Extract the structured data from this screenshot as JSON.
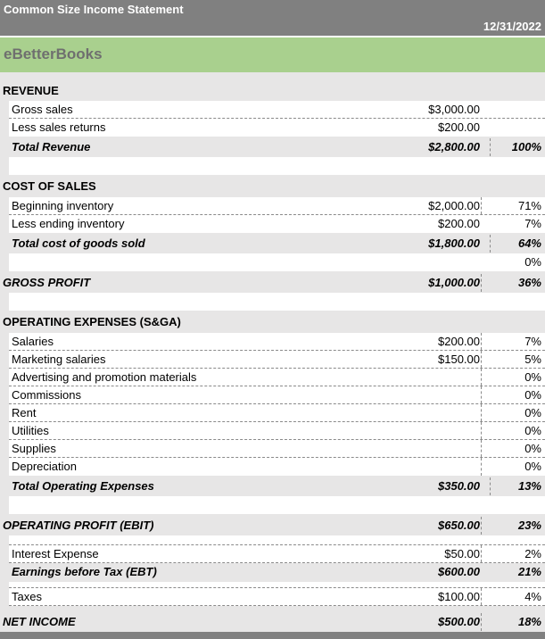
{
  "header": {
    "title": "Common Size Income Statement",
    "date": "12/31/2022",
    "company": "eBetterBooks"
  },
  "colors": {
    "title_bar": "#808080",
    "brand_band": "#a9d08e",
    "section_fill": "#e7e6e6"
  },
  "revenue": {
    "heading": "REVENUE",
    "items": [
      {
        "label": "Gross sales",
        "amount": "$3,000.00",
        "percent": ""
      },
      {
        "label": "Less sales returns",
        "amount": "$200.00",
        "percent": ""
      }
    ],
    "total": {
      "label": "Total Revenue",
      "amount": "$2,800.00",
      "percent": "100%"
    }
  },
  "cost_of_sales": {
    "heading": "COST OF SALES",
    "items": [
      {
        "label": "Beginning inventory",
        "amount": "$2,000.00",
        "percent": "71%"
      },
      {
        "label": "Less ending inventory",
        "amount": "$200.00",
        "percent": "7%"
      }
    ],
    "total": {
      "label": "Total cost of goods sold",
      "amount": "$1,800.00",
      "percent": "64%"
    },
    "extra_percent": "0%"
  },
  "gross_profit": {
    "label": "GROSS PROFIT",
    "amount": "$1,000.00",
    "percent": "36%"
  },
  "operating_expenses": {
    "heading": "OPERATING EXPENSES (S&GA)",
    "items": [
      {
        "label": "Salaries",
        "amount": "$200.00",
        "percent": "7%"
      },
      {
        "label": "Marketing salaries",
        "amount": "$150.00",
        "percent": "5%"
      },
      {
        "label": "Advertising and promotion materials",
        "amount": "",
        "percent": "0%"
      },
      {
        "label": "Commissions",
        "amount": "",
        "percent": "0%"
      },
      {
        "label": "Rent",
        "amount": "",
        "percent": "0%"
      },
      {
        "label": "Utilities",
        "amount": "",
        "percent": "0%"
      },
      {
        "label": "Supplies",
        "amount": "",
        "percent": "0%"
      },
      {
        "label": "Depreciation",
        "amount": "",
        "percent": "0%"
      }
    ],
    "total": {
      "label": "Total Operating Expenses",
      "amount": "$350.00",
      "percent": "13%"
    }
  },
  "operating_profit": {
    "label": "OPERATING PROFIT (EBIT)",
    "amount": "$650.00",
    "percent": "23%"
  },
  "interest": {
    "label": "Interest Expense",
    "amount": "$50.00",
    "percent": "2%"
  },
  "ebt": {
    "label": "Earnings before Tax (EBT)",
    "amount": "$600.00",
    "percent": "21%"
  },
  "taxes": {
    "label": "Taxes",
    "amount": "$100.00",
    "percent": "4%"
  },
  "net_income": {
    "label": "NET INCOME",
    "amount": "$500.00",
    "percent": "18%"
  }
}
